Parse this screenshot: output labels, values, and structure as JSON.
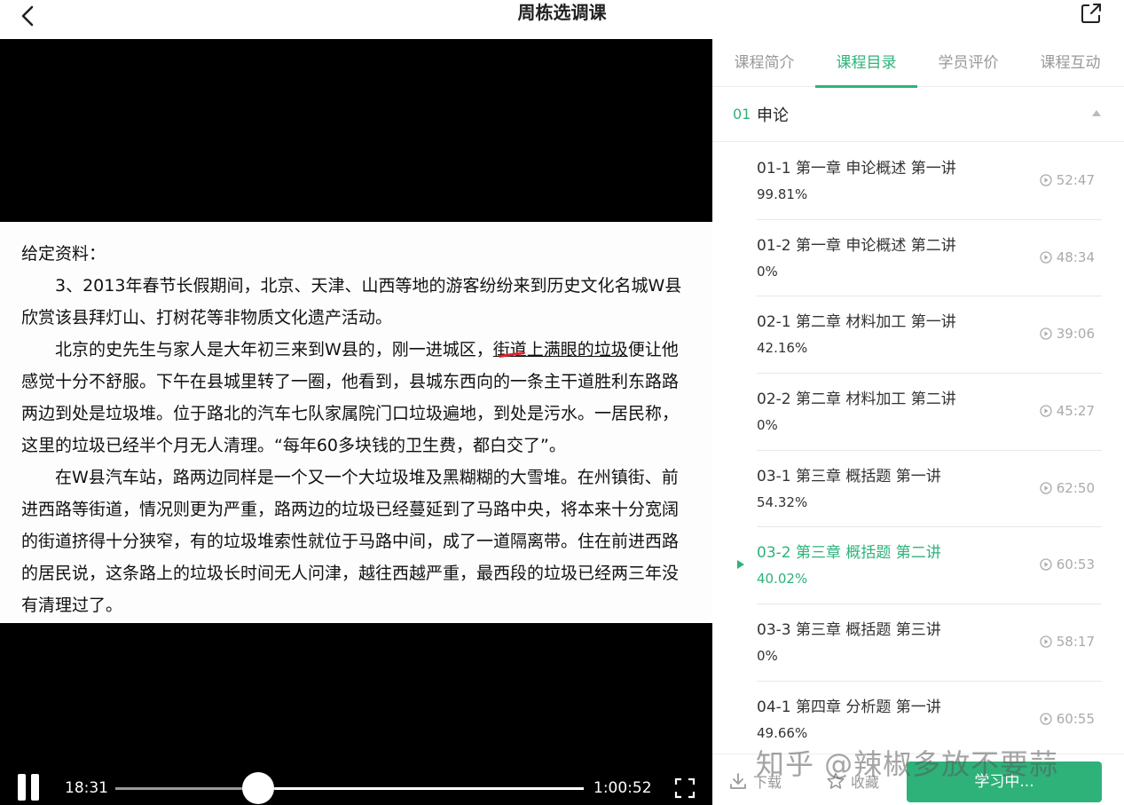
{
  "header": {
    "title": "周栋选调课"
  },
  "slide": {
    "heading": "给定资料：",
    "paragraphs": [
      "3、2013年春节长假期间，北京、天津、山西等地的游客纷纷来到历史文化名城W县欣赏该县拜灯山、打树花等非物质文化遗产活动。",
      "北京的史先生与家人是大年初三来到W县的，刚一进城区，",
      "街道上满眼的垃圾",
      "便让他感觉十分不舒服。下午在县城里转了一圈，他看到，县城东西向的一条主干道胜利东路路两边到处是垃圾堆。位于路北的汽车七队家属院门口垃圾遍地，到处是污水。一居民称，这里的垃圾已经半个月无人清理。“每年60多块钱的卫生费，都白交了”。",
      "在W县汽车站，路两边同样是一个又一个大垃圾堆及黑糊糊的大雪堆。在州镇街、前进西路等街道，情况则更为严重，路两边的垃圾已经蔓延到了马路中央，将本来十分宽阔的街道挤得十分狭窄，有的垃圾堆索性就位于马路中间，成了一道隔离带。住在前进西路的居民说，这条路上的垃圾长时间无人问津，越往西越严重，最西段的垃圾已经两三年没有清理过了。"
    ]
  },
  "player": {
    "current": "18:31",
    "duration": "1:00:52",
    "progress": 0.304
  },
  "tabs": [
    {
      "label": "课程简介"
    },
    {
      "label": "课程目录"
    },
    {
      "label": "学员评价"
    },
    {
      "label": "课程互动"
    }
  ],
  "section": {
    "num": "01",
    "name": "申论"
  },
  "lessons": [
    {
      "title": "01-1 第一章 申论概述 第一讲",
      "progress": "99.81%",
      "duration": "52:47"
    },
    {
      "title": "01-2 第一章 申论概述 第二讲",
      "progress": "0%",
      "duration": "48:34"
    },
    {
      "title": "02-1 第二章 材料加工 第一讲",
      "progress": "42.16%",
      "duration": "39:06"
    },
    {
      "title": "02-2 第二章 材料加工 第二讲",
      "progress": "0%",
      "duration": "45:27"
    },
    {
      "title": "03-1 第三章 概括题 第一讲",
      "progress": "54.32%",
      "duration": "62:50"
    },
    {
      "title": "03-2 第三章 概括题 第二讲",
      "progress": "40.02%",
      "duration": "60:53"
    },
    {
      "title": "03-3 第三章 概括题 第三讲",
      "progress": "0%",
      "duration": "58:17"
    },
    {
      "title": "04-1 第四章 分析题 第一讲",
      "progress": "49.66%",
      "duration": "60:55"
    }
  ],
  "bottom": {
    "download": "下载",
    "favorite": "收藏",
    "study": "学习中..."
  },
  "watermark": "知乎 @辣椒多放不要蒜",
  "colors": {
    "accent": "#2eb27a"
  }
}
